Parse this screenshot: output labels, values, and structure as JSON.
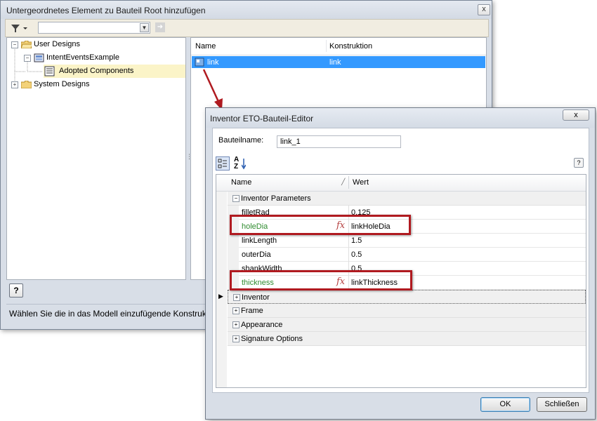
{
  "back_dialog": {
    "title": "Untergeordnetes Element zu Bauteil Root hinzufügen",
    "close_glyph": "x",
    "toolbar": {
      "filter_icon": "filter-icon",
      "combo_value": "",
      "go_icon": "arrow-right-icon"
    },
    "tree": {
      "items": [
        {
          "label": "User Designs",
          "icon": "open-folder-icon",
          "expander": "−"
        },
        {
          "label": "IntentEventsExample",
          "icon": "assembly-icon",
          "expander": "−"
        },
        {
          "label": "Adopted Components",
          "icon": "document-icon",
          "expander": ""
        },
        {
          "label": "System Designs",
          "icon": "folder-icon",
          "expander": "+"
        }
      ]
    },
    "list": {
      "columns": [
        "Name",
        "Konstruktion"
      ],
      "rows": [
        {
          "name": "link",
          "konstruktion": "link"
        }
      ]
    },
    "help_label": "?",
    "status_text": "Wählen Sie die in das Modell einzufügende Konstruk"
  },
  "front_dialog": {
    "title": "Inventor ETO-Bauteil-Editor",
    "close_glyph": "x",
    "name_label": "Bauteilname:",
    "name_value": "link_1",
    "toolbar": {
      "az_label": "A Z",
      "help_label": "?"
    },
    "grid": {
      "columns": [
        "Name",
        "Wert"
      ],
      "categories": {
        "inventor_parameters": "Inventor Parameters",
        "inventor": "Inventor",
        "frame": "Frame",
        "appearance": "Appearance",
        "signature_options": "Signature Options"
      },
      "properties": [
        {
          "name": "filletRad",
          "value": "0.125",
          "rule": false
        },
        {
          "name": "holeDia",
          "value": "linkHoleDia",
          "rule": true
        },
        {
          "name": "linkLength",
          "value": "1.5",
          "rule": false
        },
        {
          "name": "outerDia",
          "value": "0.5",
          "rule": false
        },
        {
          "name": "shankWidth",
          "value": "0.5",
          "rule": false
        },
        {
          "name": "thickness",
          "value": "linkThickness",
          "rule": true
        }
      ],
      "fx_glyph": "fx"
    },
    "buttons": {
      "ok": "OK",
      "close": "Schließen"
    }
  },
  "colors": {
    "highlight": "#b01a20",
    "rule_text": "#2e8b2e",
    "selection": "#3399ff"
  }
}
